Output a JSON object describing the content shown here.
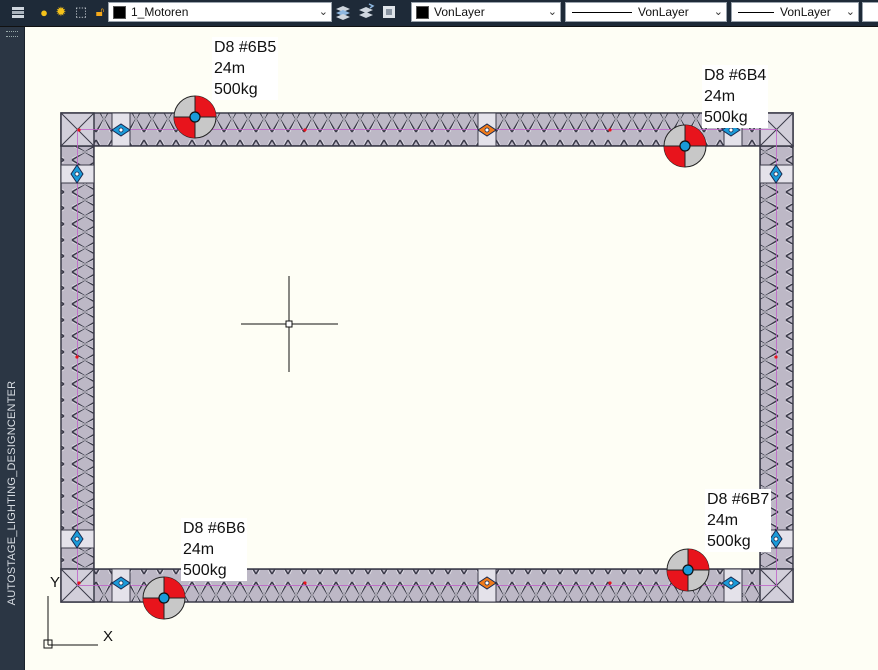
{
  "toolbar": {
    "layer_name": "1_Motoren",
    "color_value": "VonLayer",
    "linetype_value": "VonLayer",
    "lineweight_value": "VonLayer",
    "icons": [
      "layer-properties-icon",
      "lightbulb-icon",
      "sun-icon",
      "layer-freeze-icon",
      "lock-icon",
      "make-current-icon",
      "match-layer-icon",
      "layer-previous-icon"
    ]
  },
  "palette": {
    "title": "AUTOSTAGE_LIGHTING_DESIGNCENTER"
  },
  "motors": [
    {
      "name": "D8  #6B5",
      "height": "24m",
      "load": "500kg"
    },
    {
      "name": "D8  #6B4",
      "height": "24m",
      "load": "500kg"
    },
    {
      "name": "D8  #6B6",
      "height": "24m",
      "load": "500kg"
    },
    {
      "name": "D8  #6B7",
      "height": "24m",
      "load": "500kg"
    }
  ],
  "ucs": {
    "x_label": "X",
    "y_label": "Y"
  },
  "colors": {
    "background": "#fefef5",
    "truss_fill": "#bdb8c6",
    "truss_line": "#3a3a48",
    "motor_red": "#e8141c",
    "motor_grey": "#c8c8c8",
    "hook_blue": "#1a9ad8",
    "connector_orange": "#f07a1a"
  }
}
